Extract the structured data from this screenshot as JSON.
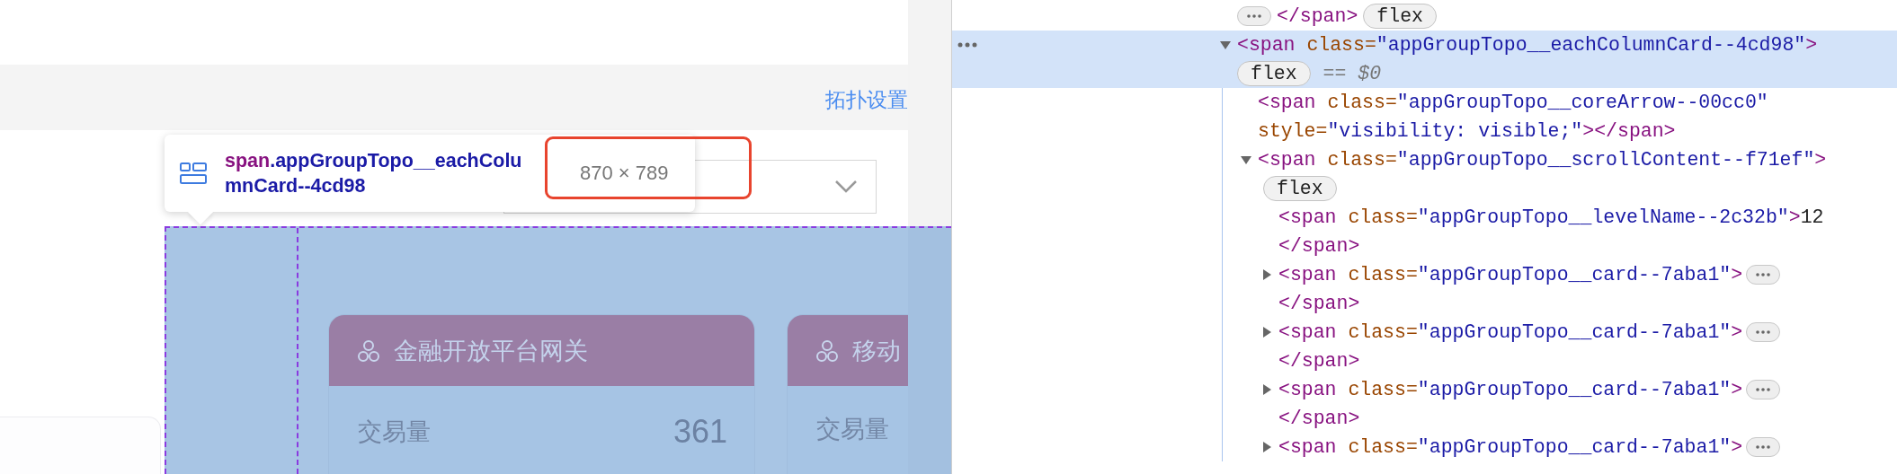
{
  "page": {
    "settings_link": "拓扑设置",
    "tooltip": {
      "tag": "span",
      "selector": ".appGroupTopo__eachColumnCard--4cd98",
      "size": "870 × 789"
    },
    "cards": [
      {
        "title": "金融开放平台网关",
        "metric_label": "交易量",
        "metric_value": "361"
      },
      {
        "title": "移动",
        "metric_label": "交易量"
      }
    ]
  },
  "devtools": {
    "nodes": [
      {
        "kind": "tail",
        "selected": false,
        "lines": [
          [
            {
              "kind": "tag",
              "text": "</span>"
            }
          ]
        ],
        "badge": "flex"
      },
      {
        "kind": "element",
        "selected": true,
        "expanded": true,
        "lines": [
          [
            {
              "kind": "tag",
              "text": "<span"
            },
            {
              "kind": "attr",
              "text": " class="
            },
            {
              "kind": "val",
              "text": "\"appGroupTopo__eachColumnCard--4cd98\""
            },
            {
              "kind": "tag",
              "text": ">"
            }
          ]
        ],
        "badge": "flex",
        "marker": "== *$0*",
        "children": [
          {
            "kind": "element",
            "selected": false,
            "lines": [
              [
                {
                  "kind": "tag",
                  "text": "<span"
                },
                {
                  "kind": "attr",
                  "text": " class="
                },
                {
                  "kind": "val",
                  "text": "\"appGroupTopo__coreArrow--00cc0\""
                }
              ],
              [
                {
                  "kind": "attr",
                  "text": "style="
                },
                {
                  "kind": "val",
                  "text": "\"visibility: visible;\""
                },
                {
                  "kind": "tag",
                  "text": "></span>"
                }
              ]
            ]
          },
          {
            "kind": "element",
            "selected": false,
            "expanded": true,
            "lines": [
              [
                {
                  "kind": "tag",
                  "text": "<span"
                },
                {
                  "kind": "attr",
                  "text": " class="
                },
                {
                  "kind": "val",
                  "text": "\"appGroupTopo__scrollContent--f71ef\""
                },
                {
                  "kind": "tag",
                  "text": ">"
                }
              ]
            ],
            "badge": "flex",
            "children": [
              {
                "kind": "element",
                "selected": false,
                "lines": [
                  [
                    {
                      "kind": "tag",
                      "text": "<span"
                    },
                    {
                      "kind": "attr",
                      "text": " class="
                    },
                    {
                      "kind": "val",
                      "text": "\"appGroupTopo__levelName--2c32b\""
                    },
                    {
                      "kind": "tag",
                      "text": ">"
                    },
                    {
                      "kind": "text",
                      "text": "12"
                    }
                  ]
                ],
                "close": [
                  {
                    "kind": "tag",
                    "text": "</span>"
                  }
                ]
              },
              {
                "kind": "element",
                "selected": false,
                "expanded": false,
                "lines": [
                  [
                    {
                      "kind": "tag",
                      "text": "<span"
                    },
                    {
                      "kind": "attr",
                      "text": " class="
                    },
                    {
                      "kind": "val",
                      "text": "\"appGroupTopo__card--7aba1\""
                    },
                    {
                      "kind": "tag",
                      "text": ">"
                    }
                  ]
                ],
                "close": [
                  {
                    "kind": "tag",
                    "text": "</span>"
                  }
                ]
              },
              {
                "kind": "element",
                "selected": false,
                "expanded": false,
                "lines": [
                  [
                    {
                      "kind": "tag",
                      "text": "<span"
                    },
                    {
                      "kind": "attr",
                      "text": " class="
                    },
                    {
                      "kind": "val",
                      "text": "\"appGroupTopo__card--7aba1\""
                    },
                    {
                      "kind": "tag",
                      "text": ">"
                    }
                  ]
                ],
                "close": [
                  {
                    "kind": "tag",
                    "text": "</span>"
                  }
                ]
              },
              {
                "kind": "element",
                "selected": false,
                "expanded": false,
                "lines": [
                  [
                    {
                      "kind": "tag",
                      "text": "<span"
                    },
                    {
                      "kind": "attr",
                      "text": " class="
                    },
                    {
                      "kind": "val",
                      "text": "\"appGroupTopo__card--7aba1\""
                    },
                    {
                      "kind": "tag",
                      "text": ">"
                    }
                  ]
                ],
                "close": [
                  {
                    "kind": "tag",
                    "text": "</span>"
                  }
                ]
              },
              {
                "kind": "element",
                "selected": false,
                "expanded": false,
                "lines": [
                  [
                    {
                      "kind": "tag",
                      "text": "<span"
                    },
                    {
                      "kind": "attr",
                      "text": " class="
                    },
                    {
                      "kind": "val",
                      "text": "\"appGroupTopo__card--7aba1\""
                    },
                    {
                      "kind": "tag",
                      "text": ">"
                    }
                  ]
                ]
              }
            ]
          }
        ]
      }
    ]
  }
}
